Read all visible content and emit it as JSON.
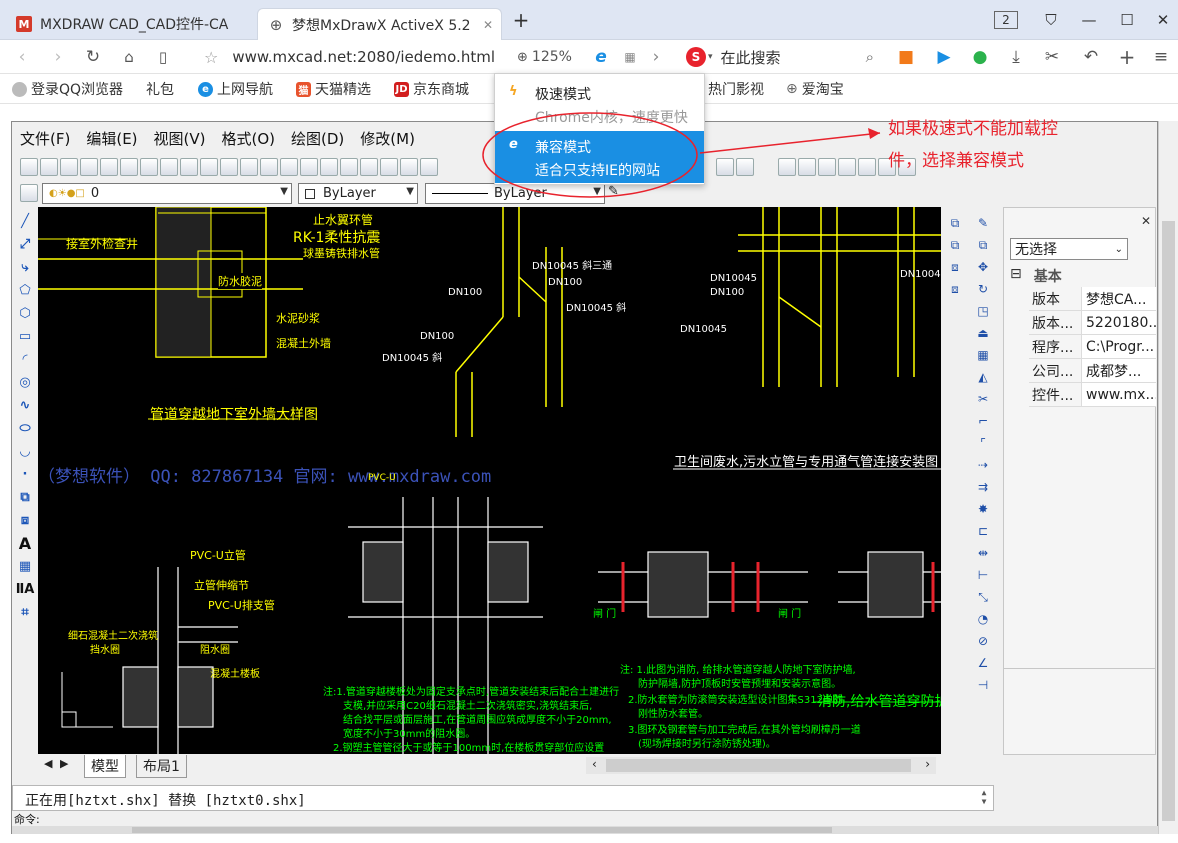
{
  "browser": {
    "tabs": [
      {
        "title": "MXDRAW CAD_CAD控件-CA",
        "active": false,
        "icon": "logo-icon"
      },
      {
        "title": "梦想MxDrawX ActiveX 5.2 ",
        "active": true,
        "icon": "globe-icon"
      }
    ],
    "new_tab_label": "+",
    "tab_count": "2",
    "colors": {
      "tab_bar": "#dfe6f3",
      "accent": "#1a8fe3",
      "annotation": "#e8232d"
    }
  },
  "navbar": {
    "url": "www.mxcad.net:2080/iedemo.html",
    "zoom": "125%",
    "search_placeholder": "在此搜索",
    "search_engine_letter": "S"
  },
  "bookmarks": [
    {
      "label": "登录QQ浏览器",
      "icon": "person-icon"
    },
    {
      "label": "礼包",
      "icon": ""
    },
    {
      "label": "上网导航",
      "icon": "e-icon"
    },
    {
      "label": "天猫精选",
      "icon": "tmall-icon"
    },
    {
      "label": "京东商城",
      "icon": "jd-icon"
    },
    {
      "label": "热门影视",
      "icon": ""
    },
    {
      "label": "爱淘宝",
      "icon": "globe-icon"
    }
  ],
  "mode_menu": {
    "fast": {
      "title": "极速模式",
      "desc": "Chrome内核，速度更快"
    },
    "compat": {
      "title": "兼容模式",
      "desc": "适合只支持IE的网站"
    }
  },
  "annotation": {
    "line1": "如果极速式不能加载控",
    "line2": "件，选择兼容模式"
  },
  "cad": {
    "menu": [
      "文件(F)",
      "编辑(E)",
      "视图(V)",
      "格式(O)",
      "绘图(D)",
      "修改(M)"
    ],
    "layer_value": "0",
    "color_value": "ByLayer",
    "linetype_value": "ByLayer",
    "properties": {
      "selection": "无选择",
      "group": "基本",
      "rows": [
        {
          "key": "版本",
          "value": "梦想CA..."
        },
        {
          "key": "版本...",
          "value": "5220180..."
        },
        {
          "key": "程序...",
          "value": "C:\\Progr..."
        },
        {
          "key": "公司...",
          "value": "成都梦..."
        },
        {
          "key": "控件...",
          "value": "www.mx..."
        }
      ]
    },
    "layout_tabs": [
      "模型",
      "布局1"
    ],
    "command_text": "正在用[hztxt.shx] 替换 [hztxt0.shx]",
    "command_prompt": "命令:"
  },
  "drawing": {
    "watermark": "（梦想软件） QQ: 827867134  官网: www.mxdraw.com",
    "title_left": "管道穿越地下室外墙大样图",
    "title_mid": "卫生间废水,污水立管与专用通气管连接安装图",
    "title_right": "消防,给水管道穿防护墙",
    "labels": {
      "outer_well": "接室外检查井",
      "rk1": "RK-1柔性抗震",
      "cast_iron": "球墨铸铁排水管",
      "waterproof": "防水胶泥",
      "cement": "水泥砂浆",
      "concrete_wall": "混凝土外墙",
      "stop_water": "止水翼环管",
      "dn100_45a": "DN10045 斜三通",
      "dn100a": "DN100",
      "dn100_45b": "DN10045 斜",
      "dn100b": "DN100",
      "dn100_45c": "DN10045 斜",
      "dn100_45r1": "DN10045",
      "dn100r": "DN100",
      "dn100_45r2": "DN10045",
      "pvc_riser": "PVC-U立管",
      "riser_clamp": "立管伸缩节",
      "pvc_drain": "PVC-U排支管",
      "fine_concrete": "细石混凝土二次浇筑",
      "water_ring": "挡水圈",
      "water_stop": "阻水圈",
      "concrete_floor": "混凝土楼板",
      "pvc_c": "PVC-U",
      "gate_valve1": "闸 门",
      "gate_valve2": "闸 门",
      "note1": "注:1.管道穿越楼板处为固定支承点时,管道安装结束后配合土建进行",
      "note2": "支模,并应采用C20细石混凝土二次浇筑密实,浇筑结束后,",
      "note3": "结合找平层或面层施工,在管道周围应筑成厚度不小于20mm,",
      "note4": "宽度不小于30mm的阻水圈。",
      "note5": "2.钢塑主管管径大于或等于100mm时,在楼板贯穿部位应设置",
      "note_r1": "注: 1.此图为消防, 给排水管道穿越人防地下室防护墙,",
      "note_r2": "防护隔墙,防护顶板时安管预埋和安装示意图。",
      "note_r3": "2.防水套管为防滚筒安装选型设计图集S312中的",
      "note_r4": "刚性防水套管。",
      "note_r5": "3.图环及钢套管与加工完成后,在其外管均刷樟丹一道",
      "note_r6": "(现场焊接时另行涂防锈处理)。"
    }
  }
}
